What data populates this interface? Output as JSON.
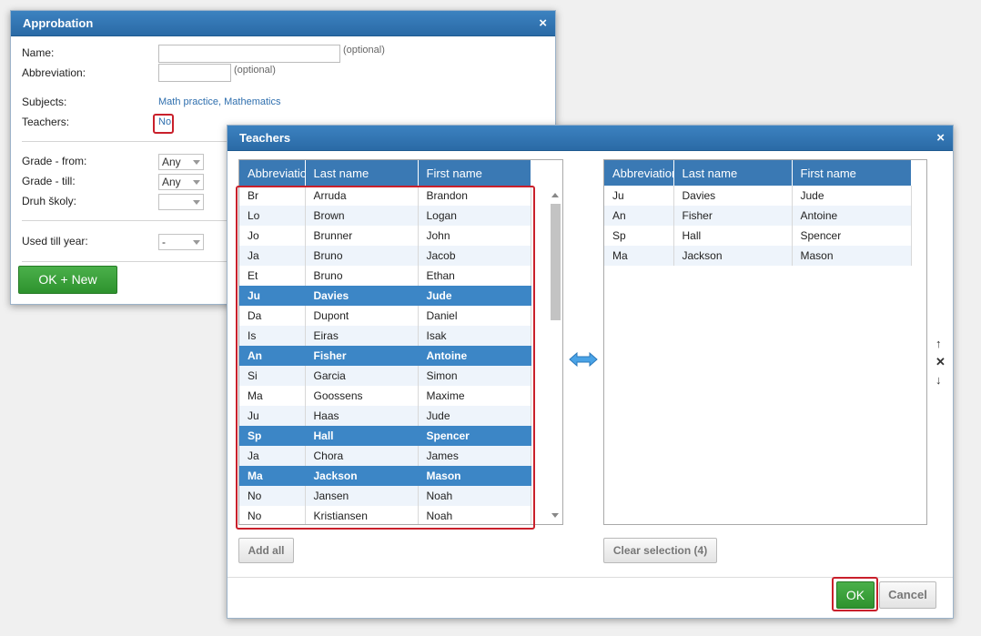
{
  "approbation": {
    "title": "Approbation",
    "close": "×",
    "name_label": "Name:",
    "name_value": "",
    "name_optional": "(optional)",
    "abbr_label": "Abbreviation:",
    "abbr_value": "",
    "abbr_optional": "(optional)",
    "subjects_label": "Subjects:",
    "subjects_value": "Math practice, Mathematics",
    "teachers_label": "Teachers:",
    "teachers_value": "No",
    "grade_from_label": "Grade - from:",
    "grade_from_value": "Any",
    "grade_till_label": "Grade - till:",
    "grade_till_value": "Any",
    "school_type_label": "Druh školy:",
    "school_type_value": "",
    "used_till_label": "Used till year:",
    "used_till_value": "-",
    "ok_new_label": "OK + New"
  },
  "teachers_dialog": {
    "title": "Teachers",
    "close": "×",
    "columns": [
      "Abbreviation",
      "Last name",
      "First name"
    ],
    "available": [
      {
        "abbr": "Br",
        "last": "Arruda",
        "first": "Brandon",
        "selected": false
      },
      {
        "abbr": "Lo",
        "last": "Brown",
        "first": "Logan",
        "selected": false
      },
      {
        "abbr": "Jo",
        "last": "Brunner",
        "first": "John",
        "selected": false
      },
      {
        "abbr": "Ja",
        "last": "Bruno",
        "first": "Jacob",
        "selected": false
      },
      {
        "abbr": "Et",
        "last": "Bruno",
        "first": "Ethan",
        "selected": false
      },
      {
        "abbr": "Ju",
        "last": "Davies",
        "first": "Jude",
        "selected": true
      },
      {
        "abbr": "Da",
        "last": "Dupont",
        "first": "Daniel",
        "selected": false
      },
      {
        "abbr": "Is",
        "last": "Eiras",
        "first": "Isak",
        "selected": false
      },
      {
        "abbr": "An",
        "last": "Fisher",
        "first": "Antoine",
        "selected": true
      },
      {
        "abbr": "Si",
        "last": "Garcia",
        "first": "Simon",
        "selected": false
      },
      {
        "abbr": "Ma",
        "last": "Goossens",
        "first": "Maxime",
        "selected": false
      },
      {
        "abbr": "Ju",
        "last": "Haas",
        "first": "Jude",
        "selected": false
      },
      {
        "abbr": "Sp",
        "last": "Hall",
        "first": "Spencer",
        "selected": true
      },
      {
        "abbr": "Ja",
        "last": "Chora",
        "first": "James",
        "selected": false
      },
      {
        "abbr": "Ma",
        "last": "Jackson",
        "first": "Mason",
        "selected": true
      },
      {
        "abbr": "No",
        "last": "Jansen",
        "first": "Noah",
        "selected": false
      },
      {
        "abbr": "No",
        "last": "Kristiansen",
        "first": "Noah",
        "selected": false
      }
    ],
    "chosen": [
      {
        "abbr": "Ju",
        "last": "Davies",
        "first": "Jude"
      },
      {
        "abbr": "An",
        "last": "Fisher",
        "first": "Antoine"
      },
      {
        "abbr": "Sp",
        "last": "Hall",
        "first": "Spencer"
      },
      {
        "abbr": "Ma",
        "last": "Jackson",
        "first": "Mason"
      }
    ],
    "transfer_icon": "double-arrow-icon",
    "move_up": "↑",
    "remove": "✕",
    "move_down": "↓",
    "add_all_label": "Add all",
    "clear_selection_label": "Clear selection (4)",
    "ok_label": "OK",
    "cancel_label": "Cancel"
  },
  "colors": {
    "header_blue": "#3a79b4",
    "selected_row": "#3c86c6",
    "ok_green": "#3a9e3a",
    "highlight_red": "#c9202b"
  }
}
